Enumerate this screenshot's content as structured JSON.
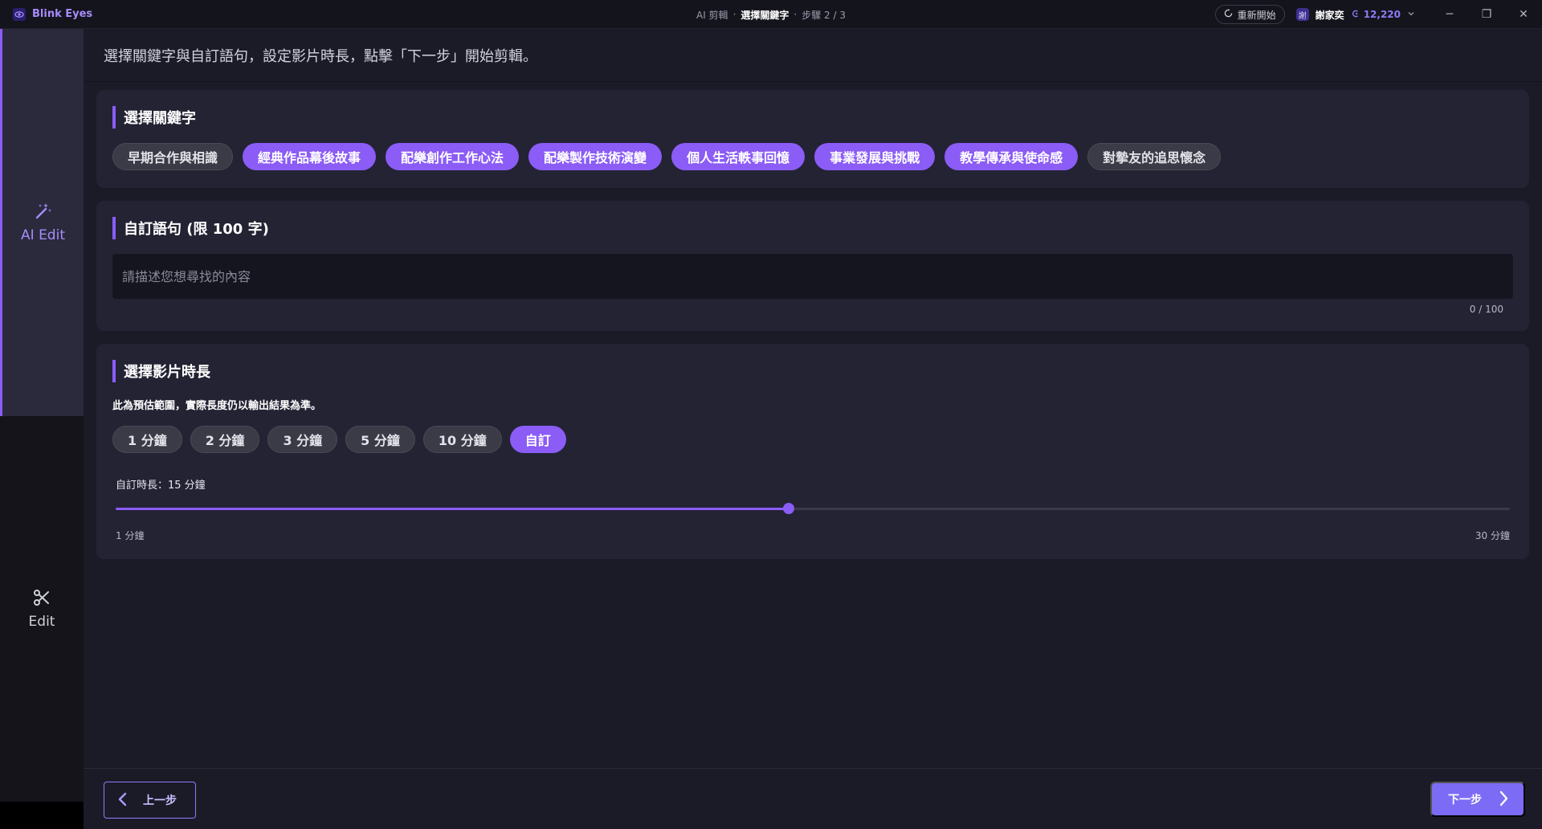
{
  "app": {
    "name": "Blink Eyes"
  },
  "titlebar": {
    "crumb_ai": "AI 剪輯",
    "sep1": "·",
    "crumb_current": "選擇關鍵字",
    "sep2": "·",
    "crumb_step": "步驟 2 / 3",
    "restart_label": "重新開始",
    "user_avatar_text": "謝",
    "user_name": "謝家奕",
    "credits": "12,220",
    "minimize": "─",
    "maximize": "❐",
    "close": "✕"
  },
  "sidebar": {
    "items": [
      {
        "label": "AI Edit",
        "icon": "magic-wand-icon",
        "active": true
      },
      {
        "label": "Edit",
        "icon": "scissors-icon",
        "active": false
      }
    ]
  },
  "instruction": "選擇關鍵字與自訂語句，設定影片時長，點擊「下一步」開始剪輯。",
  "keywords": {
    "title": "選擇關鍵字",
    "chips": [
      {
        "label": "早期合作與相識",
        "selected": false
      },
      {
        "label": "經典作品幕後故事",
        "selected": true
      },
      {
        "label": "配樂創作工作心法",
        "selected": true
      },
      {
        "label": "配樂製作技術演變",
        "selected": true
      },
      {
        "label": "個人生活軼事回憶",
        "selected": true
      },
      {
        "label": "事業發展與挑戰",
        "selected": true
      },
      {
        "label": "教學傳承與使命感",
        "selected": true
      },
      {
        "label": "對摯友的追思懷念",
        "selected": false
      }
    ]
  },
  "custom_sentence": {
    "title": "自訂語句 (限 100 字)",
    "placeholder": "請描述您想尋找的內容",
    "value": "",
    "counter": "0 / 100"
  },
  "duration": {
    "title": "選擇影片時長",
    "note": "此為預估範圍，實際長度仍以輸出結果為準。",
    "options": [
      {
        "label": "1 分鐘",
        "selected": false
      },
      {
        "label": "2 分鐘",
        "selected": false
      },
      {
        "label": "3 分鐘",
        "selected": false
      },
      {
        "label": "5 分鐘",
        "selected": false
      },
      {
        "label": "10 分鐘",
        "selected": false
      },
      {
        "label": "自訂",
        "selected": true
      }
    ],
    "custom_label": "自訂時長：15 分鐘",
    "slider": {
      "min": 1,
      "max": 30,
      "value": 15,
      "min_label": "1 分鐘",
      "max_label": "30 分鐘"
    }
  },
  "footer": {
    "prev_label": "上一步",
    "next_label": "下一步"
  },
  "colors": {
    "accent": "#8b5cf6",
    "next_button": "#7c6cf5",
    "background": "#1b1b28",
    "card": "#232334"
  }
}
